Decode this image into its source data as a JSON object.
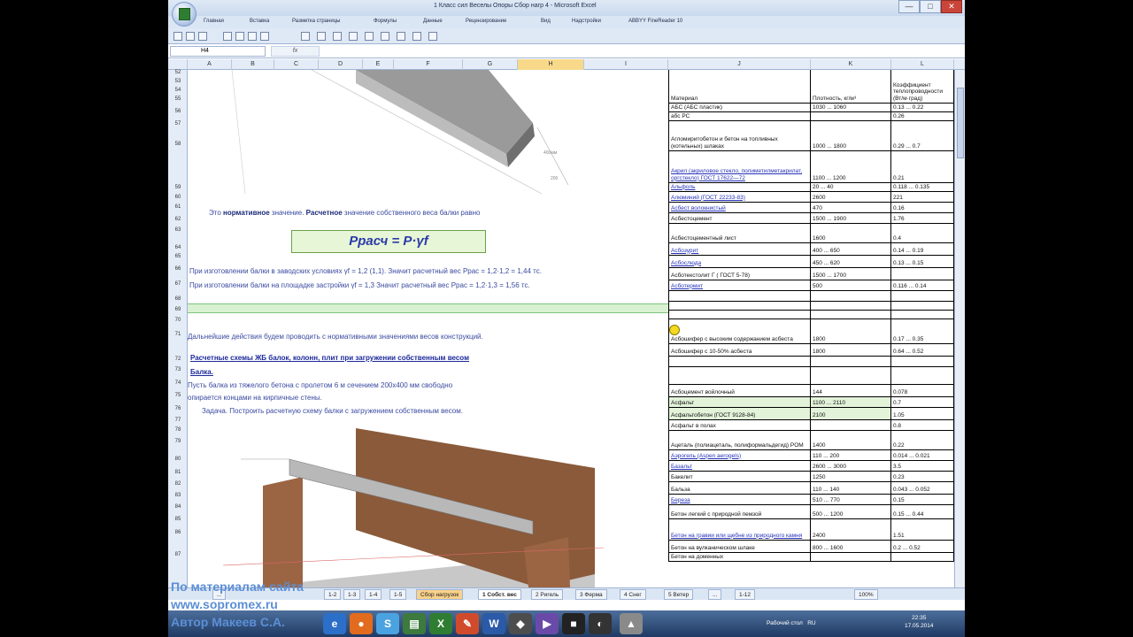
{
  "window": {
    "title": "1 Класс сил Веселы Опоры Сбор нагр 4 - Microsoft Excel",
    "minimize": "—",
    "maximize": "□",
    "close": "✕"
  },
  "ribbon_tabs": [
    "Главная",
    "Вставка",
    "Разметка страницы",
    "Формулы",
    "Данные",
    "Рецензирование",
    "Вид",
    "Надстройки",
    "ABBYY FineReader 10"
  ],
  "formula_bar": {
    "name_box": "H4",
    "fx": "fx",
    "value": ""
  },
  "columns": [
    "A",
    "B",
    "C",
    "D",
    "E",
    "F",
    "G",
    "H",
    "I",
    "J",
    "K",
    "L"
  ],
  "selected_column": "H",
  "rows": [
    "52",
    "53",
    "54",
    "55",
    "56",
    "57",
    "58",
    "59",
    "60",
    "61",
    "62",
    "63",
    "64",
    "65",
    "66",
    "67",
    "68",
    "69",
    "70",
    "71",
    "72",
    "73",
    "74",
    "75",
    "76",
    "77",
    "78",
    "79",
    "80",
    "81",
    "82",
    "83",
    "84",
    "85",
    "86",
    "87"
  ],
  "left": {
    "line61": {
      "pre": "Это ",
      "b1": "нормативное",
      "mid": " значение. ",
      "b2": "Расчетное",
      "post": " значение собственного веса балки равно"
    },
    "formula": "Pрасч = P·γf",
    "line65": "При изготовлении балки в заводских условиях γf = 1,2 (1,1). Значит расчетный вес Pрас = 1,2·1,2 = 1,44 тс.",
    "line66": "При изготовлении балки на площадке застройки γf = 1,3  Значит расчетный вес Pрас = 1,2·1,3 = 1,56 тс.",
    "line70": "Дальнейшие действия будем проводить с нормативными значениями весов конструкций.",
    "line71": "Расчетные схемы ЖБ балок, колонн, плит при загружении собственным весом",
    "line72": "Балка.",
    "line73": "Пусть балка из тяжелого бетона с пролетом 6 м сечением 200х400 мм свободно",
    "line74": "опирается концами на кирпичные стены.",
    "line75": "Задача. Построить расчетную схему балки с загружением собственным весом."
  },
  "table": {
    "headers": {
      "name": "Материал",
      "dens": "Плотность, кг/м³",
      "cond": "Коэффициент теплопроводности (Вт/м·град)"
    },
    "rows": [
      {
        "name": "АБС (АБС пластик)",
        "dens": "1030 ... 1060",
        "cond": "0.13 ... 0.22",
        "link": false
      },
      {
        "name": "абс PC",
        "dens": "",
        "cond": "0.26",
        "link": false
      },
      {
        "name": "Агломиритобетон и бетон на топливных (котельных) шлаках",
        "dens": "1000 ... 1800",
        "cond": "0.29 ... 0.7",
        "link": false
      },
      {
        "name": "Акрил (акриловое стекло, полиметилметакрилат, оргстекло) ГОСТ 17622—72",
        "dens": "1100 ... 1200",
        "cond": "0.21",
        "link": true
      },
      {
        "name": "Альфоль",
        "dens": "20 ... 40",
        "cond": "0.118 ... 0.135",
        "link": true
      },
      {
        "name": "Алюминий (ГОСТ 22233-83)",
        "dens": "2600",
        "cond": "221",
        "link": true
      },
      {
        "name": "Асбест волокнистый",
        "dens": "470",
        "cond": "0.16",
        "link": true
      },
      {
        "name": "Асбестоцемент",
        "dens": "1500 ... 1900",
        "cond": "1.76",
        "link": false
      },
      {
        "name": "Асбестоцементный лист",
        "dens": "1600",
        "cond": "0.4",
        "link": false
      },
      {
        "name": "Асбозурит",
        "dens": "400 ... 650",
        "cond": "0.14 ... 0.19",
        "link": true
      },
      {
        "name": "Асбослюда",
        "dens": "450 ... 620",
        "cond": "0.13 ... 0.15",
        "link": true
      },
      {
        "name": "Асботекстолит Г ( ГОСТ 5-78)",
        "dens": "1500 ... 1700",
        "cond": "",
        "link": false
      },
      {
        "name": "Асботермит",
        "dens": "500",
        "cond": "0.116 ... 0.14",
        "link": true
      },
      {
        "name": "",
        "dens": "",
        "cond": "",
        "link": false
      },
      {
        "name": "",
        "dens": "",
        "cond": "",
        "link": false
      },
      {
        "name": "",
        "dens": "",
        "cond": "",
        "link": false
      },
      {
        "name": "Асбошифер с высоким содержанием асбеста",
        "dens": "1800",
        "cond": "0.17 ... 0.35",
        "link": false
      },
      {
        "name": "Асбошифер с 10-50% асбеста",
        "dens": "1800",
        "cond": "0.64 ... 0.52",
        "link": false
      },
      {
        "name": "",
        "dens": "",
        "cond": "",
        "link": false
      },
      {
        "name": "",
        "dens": "",
        "cond": "",
        "link": false
      },
      {
        "name": "Асбоцемент войлочный",
        "dens": "144",
        "cond": "0.078",
        "link": false
      },
      {
        "name": "Асфальт",
        "dens": "1100 ... 2110",
        "cond": "0.7",
        "link": false
      },
      {
        "name": "Асфальтобетон (ГОСТ 9128-84)",
        "dens": "2100",
        "cond": "1.05",
        "link": false
      },
      {
        "name": "Асфальт в полах",
        "dens": "",
        "cond": "0.8",
        "link": false
      },
      {
        "name": "Ацеталь (полиацеталь, полиформальдегид) POM",
        "dens": "1400",
        "cond": "0.22",
        "link": false
      },
      {
        "name": "Аэрогель (Aspen aerogels)",
        "dens": "110 ... 200",
        "cond": "0.014 ... 0.021",
        "link": true
      },
      {
        "name": "Базальт",
        "dens": "2600 ... 3000",
        "cond": "3.5",
        "link": true
      },
      {
        "name": "Бакелит",
        "dens": "1250",
        "cond": "0.23",
        "link": false
      },
      {
        "name": "Бальза",
        "dens": "110 ... 140",
        "cond": "0.043 ... 0.052",
        "link": false
      },
      {
        "name": "Береза",
        "dens": "510 ... 770",
        "cond": "0.15",
        "link": true
      },
      {
        "name": "Бетон легкий с природной пемзой",
        "dens": "500 ... 1200",
        "cond": "0.15 ... 0.44",
        "link": false
      },
      {
        "name": "Бетон на гравии или щебне из природного камня",
        "dens": "2400",
        "cond": "1.51",
        "link": true
      },
      {
        "name": "Бетон на вулканическом шлаке",
        "dens": "800 ... 1600",
        "cond": "0.2 ... 0.52",
        "link": false
      },
      {
        "name": "Бетон на доменных",
        "dens": "",
        "cond": "",
        "link": false
      }
    ]
  },
  "sheet_tabs": [
    "...",
    "1-2",
    "1-3",
    "1-4",
    "1-5",
    "Сбор нагрузок",
    "1 Собст. вес",
    "2 Ригель",
    "3 Ферма",
    "4 Снег",
    "5 Ветер",
    "...",
    "1-12"
  ],
  "active_sheet": "1 Собст. вес",
  "status": {
    "zoom": "100%"
  },
  "taskbar": {
    "tray": "Рабочий стол",
    "lang": "RU",
    "time": "22:35",
    "date": "17.05.2014"
  },
  "watermark": [
    "По материалам сайта",
    "www.sopromex.ru",
    "Автор Макеев С.А."
  ],
  "colors": {
    "accent": "#2531b8",
    "green": "#d8f1d0"
  }
}
